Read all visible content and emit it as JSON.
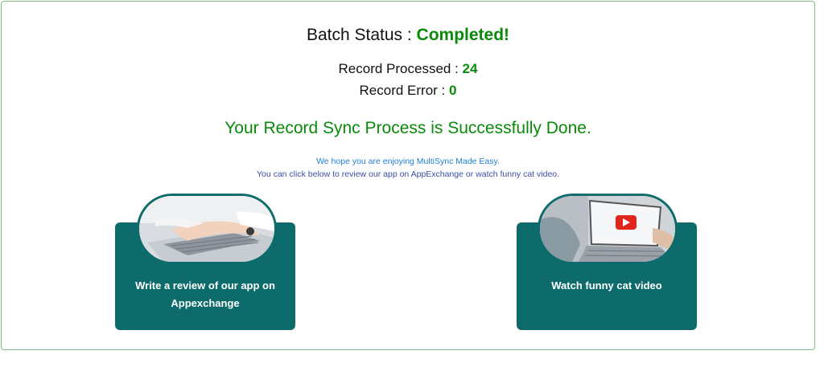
{
  "batch": {
    "status_label": "Batch Status : ",
    "status_value": "Completed!"
  },
  "metrics": {
    "processed_label": "Record Processed : ",
    "processed_value": "24",
    "error_label": "Record Error : ",
    "error_value": "0"
  },
  "message": {
    "success": "Your Record Sync Process is Successfully Done.",
    "enjoy": "We hope you are enjoying MultiSync Made Easy.",
    "review_hint": "You can click below to review our app on AppExchange or watch funny cat video."
  },
  "cards": {
    "review_label": "Write a review of our app on Appexchange",
    "video_label": "Watch funny cat video"
  },
  "colors": {
    "success_green": "#0a8a0a",
    "card_teal": "#0d6c6b",
    "border_green": "#7cc07c",
    "link_blue": "#1e7fd6"
  },
  "icons": {
    "review_image": "laptop-typing-photo",
    "video_image": "laptop-video-play-photo"
  }
}
